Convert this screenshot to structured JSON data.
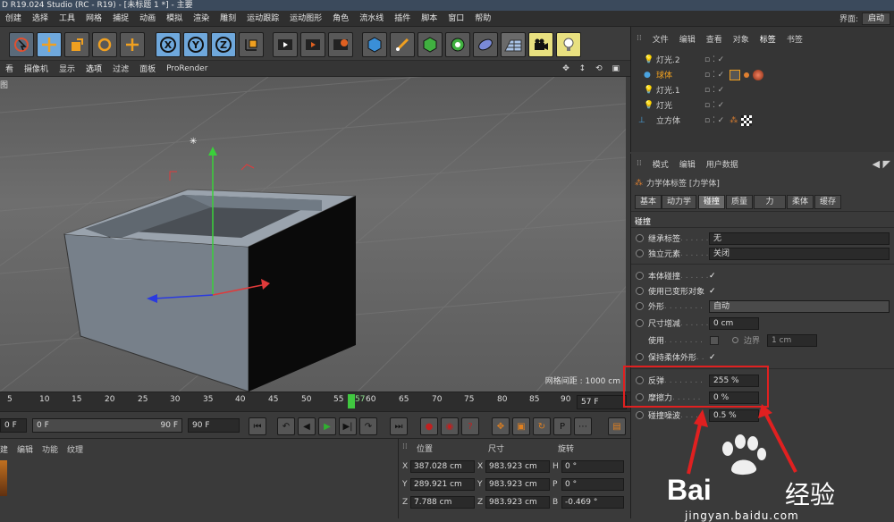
{
  "title": "D R19.024 Studio (RC - R19) - [未标题 1 *] - 主要",
  "menu": [
    "创建",
    "选择",
    "工具",
    "网格",
    "捕捉",
    "动画",
    "模拟",
    "渲染",
    "雕刻",
    "运动跟踪",
    "运动图形",
    "角色",
    "流水线",
    "插件",
    "脚本",
    "窗口",
    "帮助"
  ],
  "layout_label": "界面:",
  "layout_value": "启动",
  "viewport_menu": [
    "看",
    "摄像机",
    "显示",
    "选项",
    "过滤",
    "面板",
    "ProRender"
  ],
  "viewport_label": "图",
  "grid_spacing": "网格间距 : 1000 cm",
  "timeline": {
    "ticks": [
      "5",
      "10",
      "15",
      "20",
      "25",
      "30",
      "35",
      "40",
      "45",
      "50",
      "55",
      "57",
      "60",
      "65",
      "70",
      "75",
      "80",
      "85",
      "90"
    ],
    "current": "57 F"
  },
  "playbar": {
    "start": "0 F",
    "range_start": "0 F",
    "range_end": "90 F",
    "end": "90 F"
  },
  "mat_menu": [
    "建",
    "编辑",
    "功能",
    "纹理"
  ],
  "coords": {
    "headers": [
      "位置",
      "尺寸",
      "旋转"
    ],
    "rows": [
      {
        "axis": "X",
        "pos": "387.028 cm",
        "size_axis": "X",
        "size": "983.923 cm",
        "rot_axis": "H",
        "rot": "0 °"
      },
      {
        "axis": "Y",
        "pos": "289.921 cm",
        "size_axis": "Y",
        "size": "983.923 cm",
        "rot_axis": "P",
        "rot": "0 °"
      },
      {
        "axis": "Z",
        "pos": "7.788 cm",
        "size_axis": "Z",
        "size": "983.923 cm",
        "rot_axis": "B",
        "rot": "-0.469 °"
      }
    ]
  },
  "objmanager": {
    "menu": [
      "文件",
      "编辑",
      "查看",
      "对象",
      "标签",
      "书签"
    ],
    "objects": [
      {
        "name": "灯光.2"
      },
      {
        "name": "球体"
      },
      {
        "name": "灯光.1"
      },
      {
        "name": "灯光"
      },
      {
        "name": "立方体"
      }
    ]
  },
  "attr": {
    "menu": [
      "模式",
      "编辑",
      "用户数据"
    ],
    "tag_title": "力学体标签 [力学体]",
    "tabs": [
      "基本",
      "动力学",
      "碰撞",
      "质量",
      "力",
      "柔体",
      "缓存"
    ],
    "section": "碰撞",
    "rows": [
      {
        "label": "继承标签",
        "value": "无"
      },
      {
        "label": "独立元素",
        "value": "关闭"
      },
      {
        "label": "本体碰撞",
        "value": "✓"
      },
      {
        "label": "使用已变形对象",
        "value": "✓"
      },
      {
        "label": "外形",
        "value": "自动"
      },
      {
        "label": "尺寸增减",
        "value": "0 cm"
      },
      {
        "label": "使用",
        "value": "",
        "extra_label": "边界",
        "extra_value": "1 cm"
      },
      {
        "label": "保持柔体外形",
        "value": "✓"
      },
      {
        "label": "反弹",
        "value": "255 %"
      },
      {
        "label": "摩擦力",
        "value": "0 %"
      },
      {
        "label": "碰撞噪波",
        "value": "0.5 %"
      }
    ]
  },
  "watermark": {
    "brand": "Bai",
    "suffix": "经验",
    "url": "jingyan.baidu.com"
  },
  "colors": {
    "accent": "#4aa3e0",
    "highlight": "#e02020",
    "active_green": "#40c840"
  }
}
